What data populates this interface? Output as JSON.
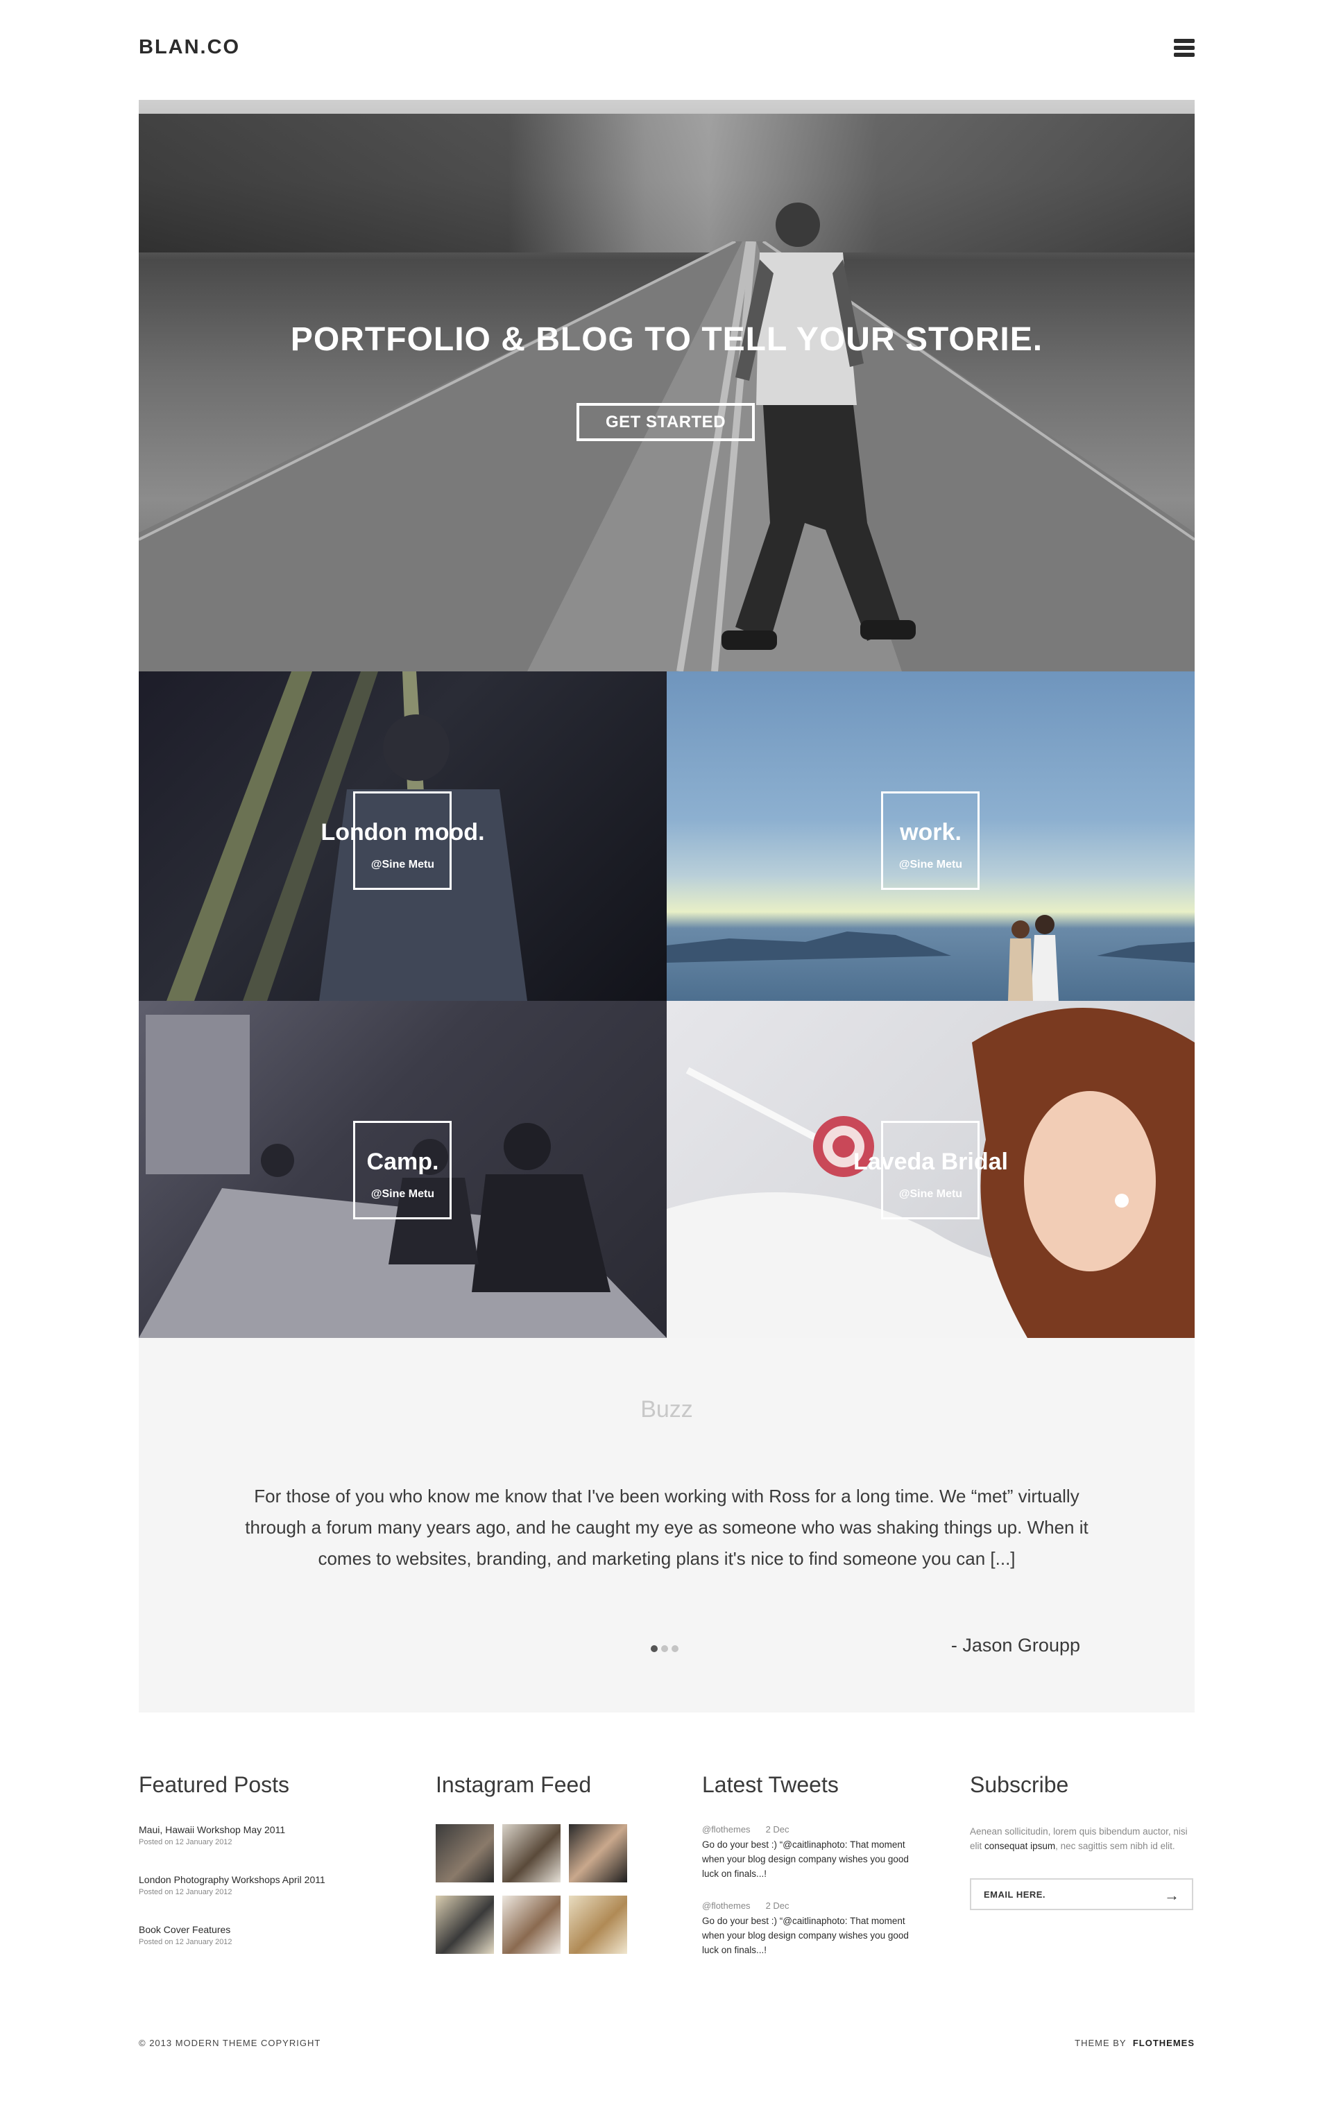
{
  "header": {
    "logo": "BLAN.CO",
    "menu_icon": "hamburger-menu-icon"
  },
  "hero": {
    "title": "PORTFOLIO & BLOG TO TELL YOUR STORIE.",
    "button_label": "GET STARTED"
  },
  "tiles": [
    {
      "name": "London mood.",
      "credit": "@Sine Metu"
    },
    {
      "name": "work.",
      "credit": "@Sine Metu"
    },
    {
      "name": "Camp.",
      "credit": "@Sine Metu"
    },
    {
      "name": "Laveda Bridal",
      "credit": "@Sine Metu"
    }
  ],
  "buzz": {
    "title": "Buzz",
    "quote": "For those of you who know me know that I've been working with Ross for a long time.  We “met” virtually through a forum many years ago, and he caught my eye as someone who was shaking things up.  When it comes to websites, branding, and marketing plans it's nice to find someone you can [...]",
    "author": "- Jason Groupp"
  },
  "featured": {
    "title": "Featured Posts",
    "posts": [
      {
        "title": "Maui, Hawaii Workshop May 2011",
        "date": "Posted on 12 January 2012"
      },
      {
        "title": "London Photography Workshops April 2011",
        "date": "Posted on 12 January 2012"
      },
      {
        "title": "Book Cover Features",
        "date": "Posted on 12 January 2012"
      }
    ]
  },
  "instagram": {
    "title": "Instagram Feed"
  },
  "tweets": {
    "title": "Latest Tweets",
    "items": [
      {
        "handle": "@flothemes",
        "date": "2 Dec",
        "text": "Go do your best :) “@caitlinaphoto: That moment when your blog design company wishes you good luck on finals...!"
      },
      {
        "handle": "@flothemes",
        "date": "2 Dec",
        "text": "Go do your best :) “@caitlinaphoto: That moment when your blog design company wishes you good luck on finals...!"
      }
    ]
  },
  "subscribe": {
    "title": "Subscribe",
    "text_pre": "Aenean sollicitudin, lorem quis bibendum auctor, nisi elit ",
    "text_strong": "consequat ipsum",
    "text_post": ", nec sagittis sem nibh id elit.",
    "placeholder": "EMAIL HERE.",
    "arrow_icon": "arrow-right-icon"
  },
  "footer": {
    "copyright": "© 2013 MODERN THEME COPYRIGHT",
    "theme_by": "THEME BY",
    "brand": "FLOTHEMES"
  },
  "colors": {
    "text": "#3a3a3a",
    "buzz_bg": "#f5f5f5",
    "white": "#ffffff"
  }
}
